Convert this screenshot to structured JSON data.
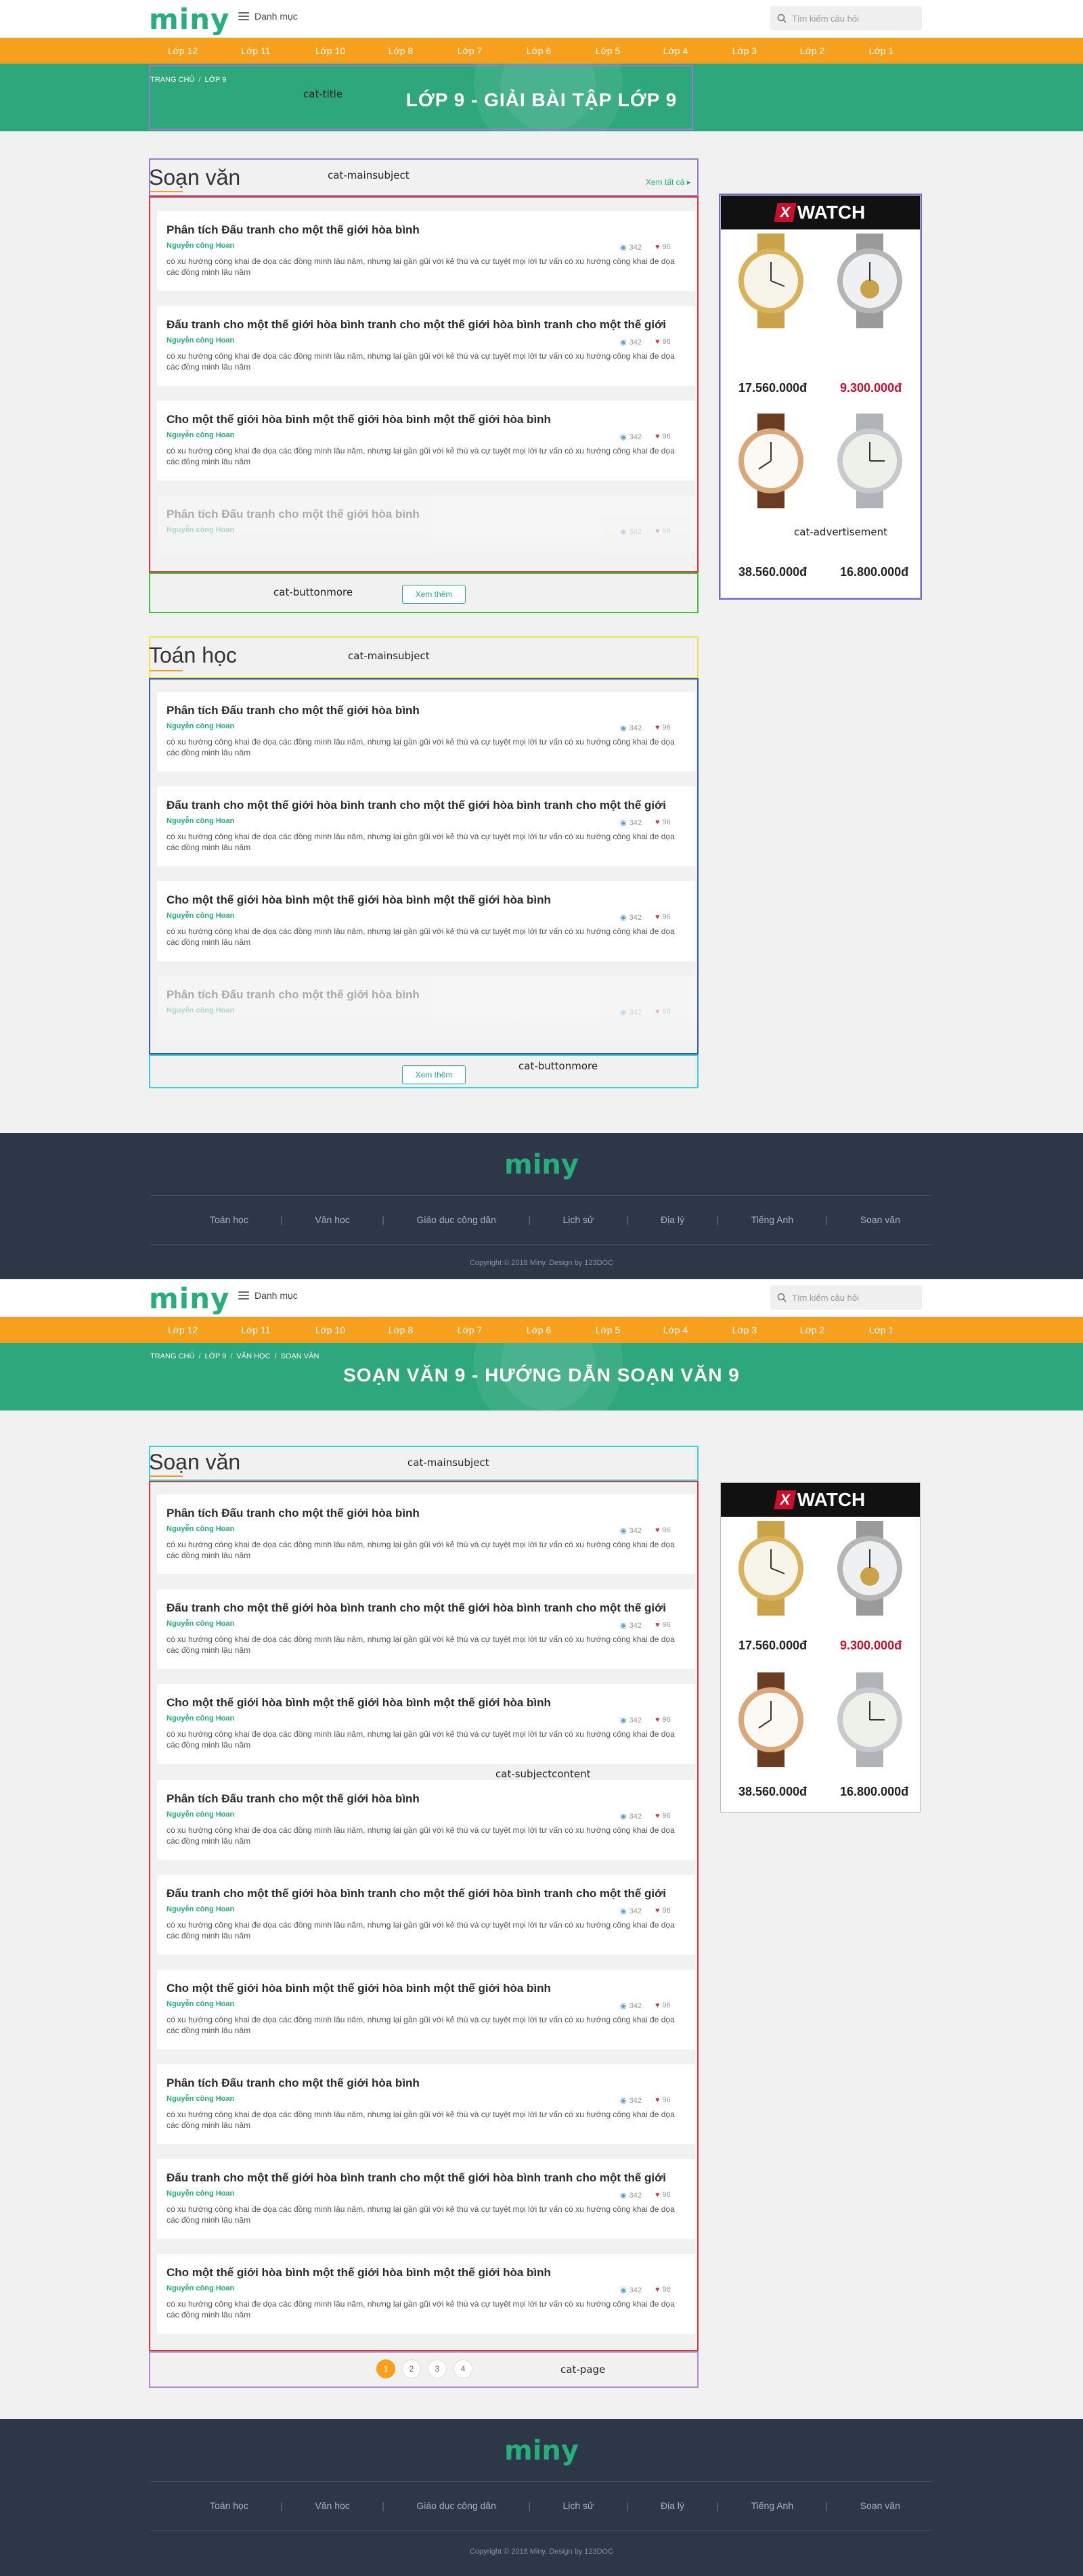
{
  "brand": {
    "logo": "miny"
  },
  "header": {
    "menu_label": "Danh mục",
    "search_placeholder": "Tìm kiếm câu hỏi"
  },
  "grades": [
    "Lớp 12",
    "Lớp 11",
    "Lớp 10",
    "Lớp 8",
    "Lớp 7",
    "Lớp 6",
    "Lớp 5",
    "Lớp 4",
    "Lớp 3",
    "Lớp 2",
    "Lớp 1"
  ],
  "page1": {
    "breadcrumb": [
      "TRANG CHỦ",
      "LỚP 9"
    ],
    "title": "LỚP 9 - GIẢI BÀI TẬP LỚP 9",
    "annotations": {
      "title": "cat-title",
      "mainsubject1": "cat-mainsubject",
      "subjectcontent1": "cat-subjectcontent",
      "buttonmore1": "cat-buttonmore",
      "advertisement": "cat-advertisement",
      "mainsubject2": "cat-mainsubject",
      "subjectcontent2": "cat-subjectcontent",
      "buttonmore2": "cat-buttonmore"
    },
    "section1": {
      "title": "Soạn văn",
      "see_all": "Xem tất cả ▸",
      "more": "Xem thêm"
    },
    "section2": {
      "title": "Toán học",
      "more": "Xem thêm"
    }
  },
  "page2": {
    "breadcrumb": [
      "TRANG CHỦ",
      "LỚP 9",
      "VĂN HỌC",
      "SOẠN VĂN"
    ],
    "title": "SOẠN VĂN 9 - HƯỚNG DẪN SOẠN VĂN 9",
    "annotations": {
      "mainsubject": "cat-mainsubject",
      "subjectcontent": "cat-subjectcontent",
      "page": "cat-page"
    },
    "section": {
      "title": "Soạn văn"
    },
    "pagination": [
      "1",
      "2",
      "3",
      "4"
    ]
  },
  "article_titles": [
    "Phân tích Đấu tranh cho một thế giới hòa bình",
    "Đấu tranh cho một thế giới hòa bình tranh cho một thế giới hòa bình tranh cho một thế giới",
    "Cho một thế giới hòa bình một thế giới hòa bình một thế giới hòa bình"
  ],
  "article": {
    "author": "Nguyễn công Hoan",
    "desc": "có xu hướng công khai đe dọa các đồng minh lâu năm, nhưng lại gần gũi với kẻ thù và cự tuyệt mọi lời tư vấn có xu hướng công khai đe dọa các đồng minh lâu năm",
    "views": "342",
    "likes": "96"
  },
  "ad": {
    "brand": "WATCH",
    "prices": [
      "17.560.000đ",
      "9.300.000đ",
      "38.560.000đ",
      "16.800.000đ"
    ]
  },
  "footer": {
    "links": [
      "Toán học",
      "Văn học",
      "Giáo dục công dân",
      "Lịch sử",
      "Địa lý",
      "Tiếng Anh",
      "Soạn văn"
    ],
    "separator": "|",
    "copyright": "Copyright © 2018 Miny. Design by 123DOC"
  },
  "colors": {
    "brand_green": "#27ae7d",
    "orange": "#f7a01e",
    "footer": "#2e3747",
    "price_red": "#c8102e"
  }
}
